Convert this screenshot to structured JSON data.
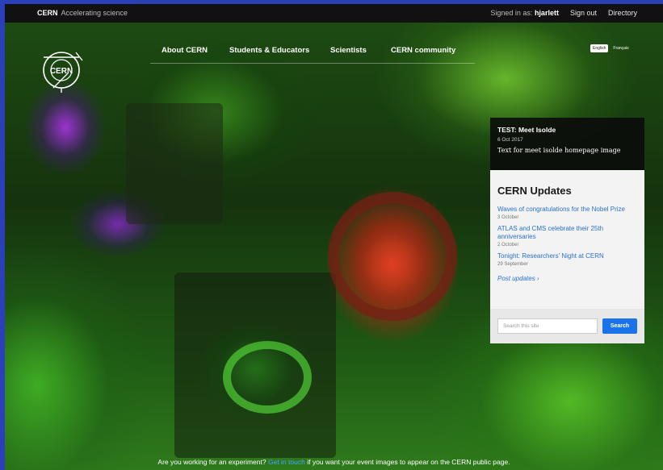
{
  "topbar": {
    "brand_strong": "CERN",
    "brand_tagline": "Accelerating science",
    "signed_in_label": "Signed in as:",
    "signed_in_user": "hjarlett",
    "sign_out": "Sign out",
    "directory": "Directory"
  },
  "logo": {
    "text": "CERN"
  },
  "nav": {
    "items": [
      {
        "label": "About CERN"
      },
      {
        "label": "Students & Educators"
      },
      {
        "label": "Scientists"
      },
      {
        "label": "CERN community"
      }
    ]
  },
  "language": {
    "english": "English",
    "french": "Français"
  },
  "teaser": {
    "title": "TEST: Meet Isolde",
    "date": "6 Oct 2017",
    "text": "Text for meet isolde homepage image"
  },
  "updates": {
    "heading": "CERN Updates",
    "items": [
      {
        "title": "Waves of congratulations for the Nobel Prize",
        "date": "3 October"
      },
      {
        "title": "ATLAS and CMS celebrate their 25th anniversaries",
        "date": "2 October"
      },
      {
        "title": "Tonight: Researchers' Night at CERN",
        "date": "29 September"
      }
    ],
    "more": "Post updates ›",
    "search_placeholder": "Search this site",
    "search_button": "Search"
  },
  "footer": {
    "before": "Are you working for an experiment?",
    "link": "Get in touch",
    "after": "if you want your event images to appear on the CERN public page."
  },
  "colors": {
    "accent": "#1a73e8",
    "link": "#2a6fd1",
    "frame": "#2b3fb8"
  }
}
